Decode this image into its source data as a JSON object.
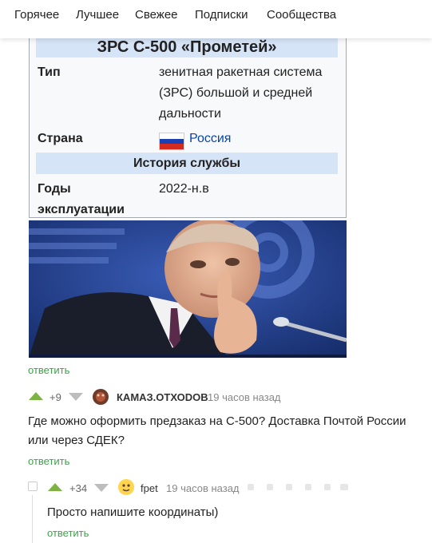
{
  "nav": {
    "items": [
      "Горячее",
      "Лучшее",
      "Свежее",
      "Подписки",
      "Сообщества"
    ]
  },
  "infobox": {
    "title": "ЗРС С-500 «Прометей»",
    "type_label": "Тип",
    "type_value": "зенитная ракетная система (ЗРС) большой и средней дальности",
    "country_label": "Страна",
    "country_value": "Россия",
    "section": "История службы",
    "years_label": "Годы эксплуатации",
    "years_value": "2022-н.в"
  },
  "comments": {
    "reply_label": "ответить",
    "c1": {
      "rating": "+9",
      "author": "КАМАЗ.ОТХОDОВ",
      "time": "19 часов назад",
      "text": "Где можно оформить предзаказ на С-500? Доставка Почтой России или через СДЕК?"
    },
    "c2": {
      "rating": "+34",
      "author": "fpet",
      "time": "19 часов назад",
      "text": "Просто напишите координаты)"
    }
  },
  "colors": {
    "accent_green": "#3fa14b",
    "infobox_header": "#d6e4f7",
    "link_blue": "#0645ad"
  }
}
